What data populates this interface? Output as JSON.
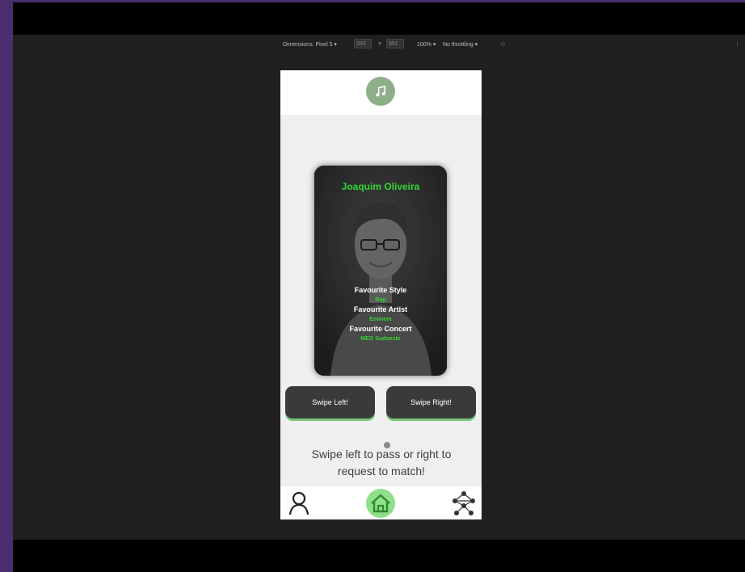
{
  "devtools": {
    "device": "Dimensions: Pixel 5 ▾",
    "width": "393",
    "separator": "×",
    "height": "851",
    "zoom": "100% ▾",
    "throttling": "No throttling ▾"
  },
  "header": {
    "logo_icon": "music-note-icon"
  },
  "card": {
    "name": "Joaquim Oliveira",
    "photo_icon": "profile-photo",
    "fields": [
      {
        "label": "Favourite Style",
        "value": "Rap"
      },
      {
        "label": "Favourite Artist",
        "value": "Eminem"
      },
      {
        "label": "Favourite Concert",
        "value": "MEO Sudoeste"
      }
    ]
  },
  "buttons": {
    "swipe_left": "Swipe Left!",
    "swipe_right": "Swipe Right!"
  },
  "hint": "Swipe left to pass or right to request to match!",
  "nav": {
    "profile_icon": "user-icon",
    "home_icon": "home-icon",
    "network_icon": "network-icon"
  },
  "colors": {
    "accent_green": "#33d633",
    "home_bg": "#8ee08a",
    "logo_bg": "#8fae8a",
    "button_bg": "#3a3a3a",
    "frame_purple": "#4a2f6e"
  }
}
